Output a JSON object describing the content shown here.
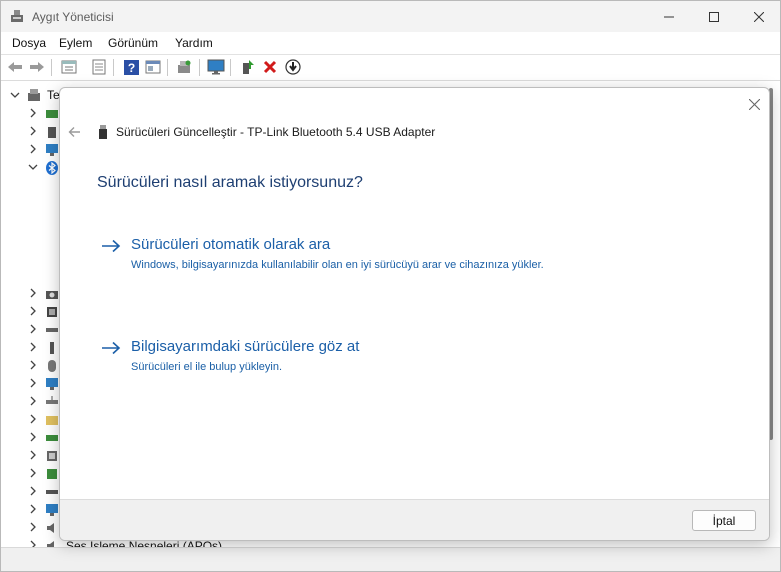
{
  "window": {
    "title": "Aygıt Yöneticisi"
  },
  "menu": {
    "items": [
      "Dosya",
      "Eylem",
      "Görünüm",
      "Yardım"
    ]
  },
  "toolbar": {
    "icons": [
      "back-arrow-icon",
      "forward-arrow-icon",
      "properties-icon",
      "list-icon",
      "help-icon",
      "view-icon",
      "scan-hardware-icon",
      "monitor-icon",
      "add-driver-icon",
      "uninstall-x-icon",
      "download-driver-icon"
    ]
  },
  "tree": {
    "root_label": "Te",
    "bottom_label": "Ses İşleme Nesneleri (APOs)"
  },
  "dialog": {
    "title": "Sürücüleri Güncelleştir - TP-Link Bluetooth 5.4 USB Adapter",
    "heading": "Sürücüleri nasıl aramak istiyorsunuz?",
    "option_auto": {
      "title": "Sürücüleri otomatik olarak ara",
      "desc": "Windows, bilgisayarınızda kullanılabilir olan en iyi sürücüyü arar ve cihazınıza yükler."
    },
    "option_browse": {
      "title": "Bilgisayarımdaki sürücülere göz at",
      "desc": "Sürücüleri el ile bulup yükleyin."
    },
    "cancel_label": "İptal"
  },
  "colors": {
    "link": "#1b5fa8",
    "heading": "#1e3f72",
    "accent_blue": "#0067c0",
    "error_red": "#d11b1b"
  }
}
